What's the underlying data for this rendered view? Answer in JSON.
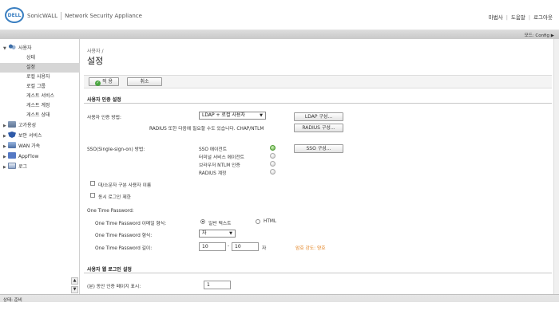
{
  "header": {
    "logo_text": "DELL",
    "brand": "SonicWALL",
    "product": "Network Security Appliance",
    "links": [
      "마법사",
      "도움말",
      "로그아웃"
    ]
  },
  "modebar": {
    "mode": "모드: Config ▶"
  },
  "sidebar": {
    "users_group": "사용자",
    "sub_items": [
      "상태",
      "설정",
      "로컬 사용자",
      "로컬 그룹",
      "게스트 서비스",
      "게스트 계정",
      "게스트 상태"
    ],
    "top_items": [
      "고가용성",
      "보안 서비스",
      "WAN 가속",
      "AppFlow",
      "로그"
    ]
  },
  "main": {
    "breadcrumb": "사용자 /",
    "title": "설정",
    "apply_label": "적 용",
    "cancel_label": "취소",
    "auth_section": "사용자 인증 설정",
    "auth_method_label": "사용자 인증 방법:",
    "auth_method_value": "LDAP + 로컬 사용자",
    "ldap_config_btn": "LDAP 구성...",
    "radius_note": "RADIUS 또한 다음에 필요할 수도 있습니다. CHAP/NTLM",
    "radius_config_btn": "RADIUS 구성...",
    "sso_label": "SSO(Single-sign-on) 방법:",
    "sso_items": [
      "SSO 에이전트",
      "터미널 서비스 에이전트",
      "브라우저 NTLM 인증",
      "RADIUS 계정"
    ],
    "sso_config_btn": "SSO 구성...",
    "case_label": "대/소문자 구분 사용자 이름",
    "concurrent_label": "동시 로그인 제한",
    "otp_header": "One Time Password:",
    "otp_format_label": "One Time Password 이메일 형식:",
    "otp_plain": "일반 텍스트",
    "otp_html": "HTML",
    "otp_type_label": "One Time Password 형식:",
    "otp_type_value": "자",
    "otp_length_label": "One Time Password 길이:",
    "otp_min": "10",
    "otp_dash": "-",
    "otp_max": "10",
    "otp_unit": "자",
    "strength_text": "암호 강도: 양호",
    "web_section": "사용자 웹 로그인 설정",
    "web_show_label": "(분) 동안 인증 페이지 표시:",
    "web_show_value": "1"
  },
  "status": {
    "text": "상태: 준비"
  }
}
